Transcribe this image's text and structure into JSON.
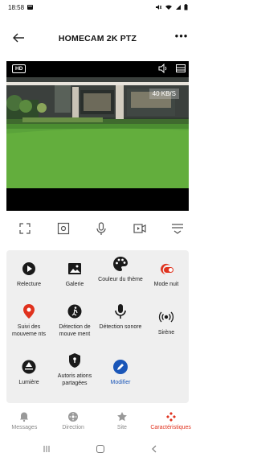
{
  "status_bar": {
    "time": "18:58"
  },
  "header": {
    "title": "HOMECAM 2K PTZ",
    "more": "•••"
  },
  "video": {
    "quality_badge": "HD",
    "speed": "40 KB/S"
  },
  "features": [
    {
      "label": "Relecture",
      "icon": "play-circle-icon"
    },
    {
      "label": "Galerie",
      "icon": "gallery-icon"
    },
    {
      "label": "Couleur du thème",
      "icon": "palette-icon"
    },
    {
      "label": "Mode nuit",
      "icon": "night-mode-icon"
    },
    {
      "label": "Suivi des mouveme nts",
      "icon": "location-pin-icon"
    },
    {
      "label": "Détection de mouve ment",
      "icon": "motion-person-icon"
    },
    {
      "label": "Détection sonore",
      "icon": "microphone-icon"
    },
    {
      "label": "Sirène",
      "icon": "siren-icon"
    },
    {
      "label": "Lumière",
      "icon": "light-icon"
    },
    {
      "label": "Autoris ations partagées",
      "icon": "shield-icon"
    },
    {
      "label": "Modifier",
      "icon": "edit-icon"
    }
  ],
  "tabs": [
    {
      "label": "Messages",
      "icon": "bell-icon"
    },
    {
      "label": "Direction",
      "icon": "direction-pad-icon"
    },
    {
      "label": "Site",
      "icon": "star-icon"
    },
    {
      "label": "Caractéristiques",
      "icon": "features-icon",
      "active": true
    }
  ],
  "colors": {
    "accent": "#e0321e",
    "link_blue": "#1a56b8",
    "grid_bg": "#efefef"
  }
}
